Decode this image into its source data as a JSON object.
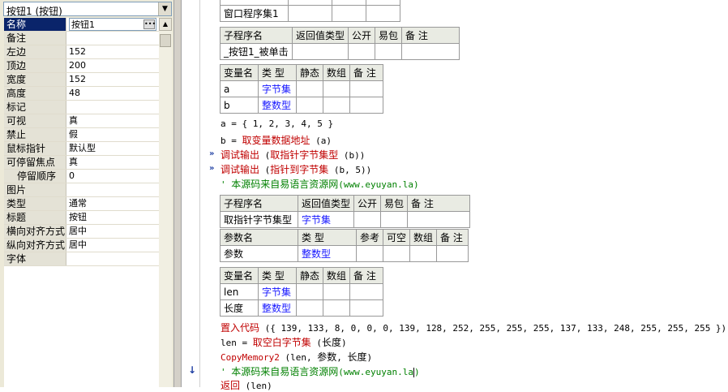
{
  "object_combo": {
    "value": "按钮1 (按钮)"
  },
  "properties": [
    {
      "name": "名称",
      "value": "按钮1",
      "selected": true
    },
    {
      "name": "备注",
      "value": ""
    },
    {
      "name": "左边",
      "value": "152"
    },
    {
      "name": "顶边",
      "value": "200"
    },
    {
      "name": "宽度",
      "value": "152"
    },
    {
      "name": "高度",
      "value": "48"
    },
    {
      "name": "标记",
      "value": ""
    },
    {
      "name": "可视",
      "value": "真"
    },
    {
      "name": "禁止",
      "value": "假"
    },
    {
      "name": "鼠标指针",
      "value": "默认型"
    },
    {
      "name": "可停留焦点",
      "value": "真"
    },
    {
      "name": "停留顺序",
      "value": "0",
      "indent": true
    },
    {
      "name": "图片",
      "value": ""
    },
    {
      "name": "类型",
      "value": "通常"
    },
    {
      "name": "标题",
      "value": "按钮"
    },
    {
      "name": "横向对齐方式",
      "value": "居中"
    },
    {
      "name": "纵向对齐方式",
      "value": "居中"
    },
    {
      "name": "字体",
      "value": ""
    }
  ],
  "editor": {
    "top_table": {
      "cell": "窗口程序集1"
    },
    "sub1": {
      "headers": [
        "子程序名",
        "返回值类型",
        "公开",
        "易包",
        "备 注"
      ],
      "row": [
        "_按钮1_被单击",
        "",
        "",
        "",
        ""
      ]
    },
    "vars1": {
      "headers": [
        "变量名",
        "类 型",
        "静态",
        "数组",
        "备 注"
      ],
      "rows": [
        [
          "a",
          "字节集",
          "",
          "",
          ""
        ],
        [
          "b",
          "整数型",
          "",
          "",
          ""
        ]
      ]
    },
    "lines1": [
      "a = { 1, 2, 3, 4, 5 }",
      "b = 取变量数据地址 (a)",
      "调试输出 (取指针字节集型 (b))",
      "调试输出 (指针到字节集 (b, 5))",
      "' 本源码来自易语言资源网(www.eyuyan.la)"
    ],
    "sub2": {
      "headers": [
        "子程序名",
        "返回值类型",
        "公开",
        "易包",
        "备 注"
      ],
      "row": [
        "取指针字节集型",
        "字节集",
        "",
        "",
        ""
      ],
      "param_headers": [
        "参数名",
        "类 型",
        "参考",
        "可空",
        "数组",
        "备 注"
      ],
      "param_row": [
        "参数",
        "整数型",
        "",
        "",
        "",
        ""
      ]
    },
    "vars2": {
      "headers": [
        "变量名",
        "类 型",
        "静态",
        "数组",
        "备 注"
      ],
      "rows": [
        [
          "len",
          "字节集",
          "",
          "",
          ""
        ],
        [
          "长度",
          "整数型",
          "",
          "",
          ""
        ]
      ]
    },
    "lines2": [
      "置入代码 ({ 139, 133, 8, 0, 0, 0, 139, 128, 252, 255, 255, 255, 137, 133, 248, 255, 255, 255 })",
      "len = 取空白字节集 (长度)",
      "CopyMemory2 (len, 参数, 长度)",
      "' 本源码来自易语言资源网(www.eyuyan.la)",
      "返回 (len)"
    ]
  },
  "colors": {
    "type_link": "#1717ff",
    "comment": "#008000",
    "command": "#c00000",
    "selection": "#0a246a"
  },
  "icons": {
    "combo_dropdown": "chevron-down-icon",
    "ellipsis": "ellipsis-icon",
    "scroll_up": "scroll-up-icon",
    "gutter_marker": "double-arrow-icon",
    "current_line": "down-arrow-icon"
  }
}
